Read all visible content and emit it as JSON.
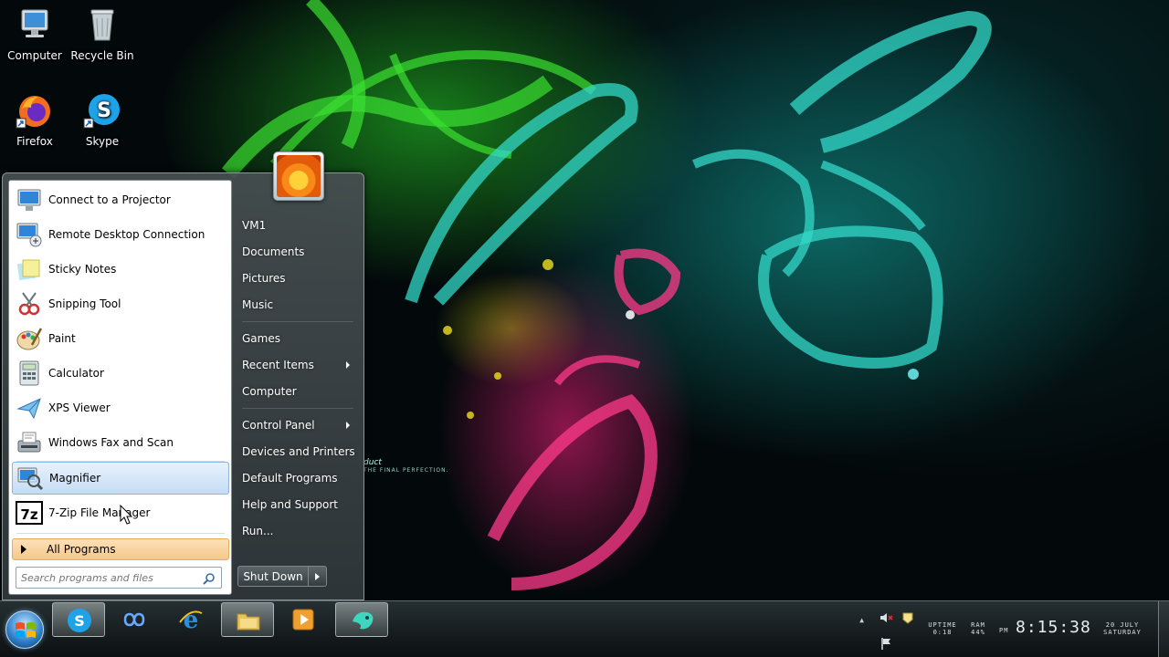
{
  "desktop": {
    "icons": [
      {
        "label": "Computer"
      },
      {
        "label": "Recycle Bin"
      },
      {
        "label": "Firefox"
      },
      {
        "label": "Skype"
      }
    ],
    "wallpaper_text": "duct",
    "wallpaper_subtext": "THE FINAL PERFECTION."
  },
  "start_menu": {
    "programs": [
      {
        "label": "Connect to a Projector",
        "icon": "projector-icon"
      },
      {
        "label": "Remote Desktop Connection",
        "icon": "remote-desktop-icon"
      },
      {
        "label": "Sticky Notes",
        "icon": "sticky-notes-icon"
      },
      {
        "label": "Snipping Tool",
        "icon": "snipping-tool-icon"
      },
      {
        "label": "Paint",
        "icon": "paint-icon"
      },
      {
        "label": "Calculator",
        "icon": "calculator-icon"
      },
      {
        "label": "XPS Viewer",
        "icon": "xps-viewer-icon"
      },
      {
        "label": "Windows Fax and Scan",
        "icon": "fax-scan-icon"
      },
      {
        "label": "Magnifier",
        "icon": "magnifier-icon",
        "highlighted": true
      },
      {
        "label": "7-Zip File Manager",
        "icon": "7zip-icon"
      }
    ],
    "all_programs": "All Programs",
    "search_placeholder": "Search programs and files",
    "right_items": [
      {
        "label": "VM1"
      },
      {
        "label": "Documents"
      },
      {
        "label": "Pictures"
      },
      {
        "label": "Music"
      },
      {
        "label": "Games"
      },
      {
        "label": "Recent Items",
        "submenu": true
      },
      {
        "label": "Computer"
      },
      {
        "label": "Control Panel",
        "submenu": true
      },
      {
        "label": "Devices and Printers"
      },
      {
        "label": "Default Programs"
      },
      {
        "label": "Help and Support"
      },
      {
        "label": "Run..."
      }
    ],
    "shutdown_label": "Shut Down"
  },
  "taskbar": {
    "buttons": [
      {
        "icon": "skype-icon",
        "active": true
      },
      {
        "icon": "infinity-icon",
        "active": false
      },
      {
        "icon": "internet-explorer-icon",
        "active": false
      },
      {
        "icon": "file-explorer-icon",
        "active": true
      },
      {
        "icon": "media-player-icon",
        "active": false
      },
      {
        "icon": "app-bird-icon",
        "active": true
      }
    ],
    "tray": {
      "uptime_label": "UPTIME",
      "uptime_value": "0:18",
      "ram_label": "RAM",
      "ram_value": "44%",
      "ampm": "PM",
      "time": "8:15:38",
      "date": "20 JULY",
      "weekday": "SATURDAY"
    }
  }
}
